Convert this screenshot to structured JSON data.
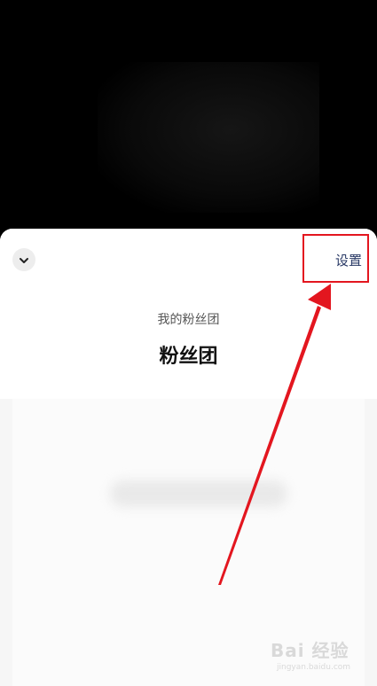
{
  "header": {
    "settings_label": "设置",
    "subtitle": "我的粉丝团",
    "title": "粉丝团"
  },
  "icons": {
    "collapse": "chevron-down-icon"
  },
  "annotation": {
    "highlight_color": "#e3161f",
    "arrow_color": "#e3161f"
  },
  "watermark": {
    "text": "Bai 经验",
    "url": "jingyan.baidu.com"
  }
}
